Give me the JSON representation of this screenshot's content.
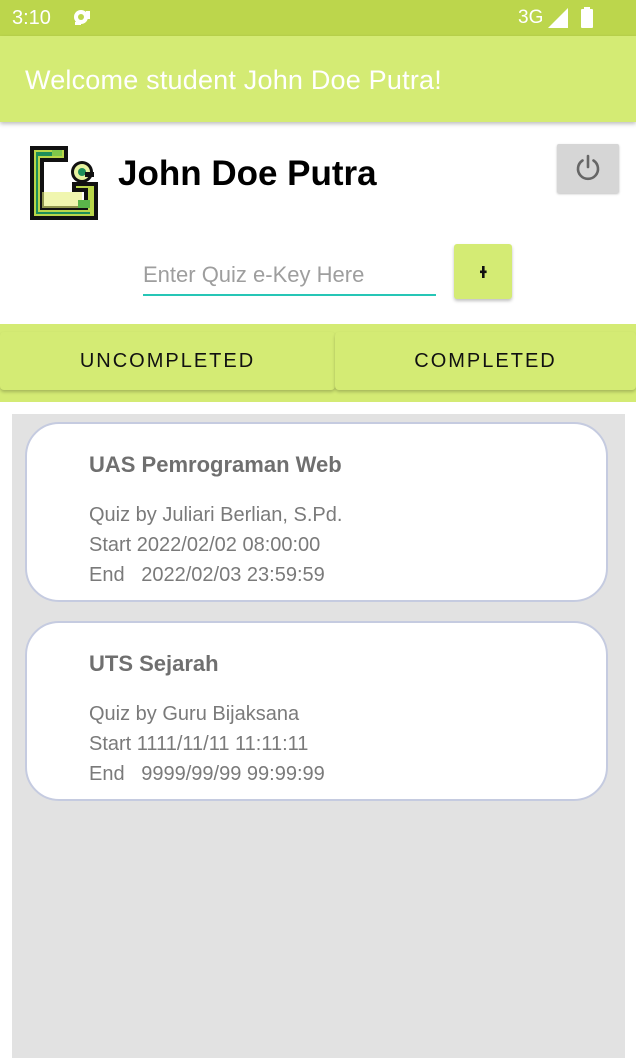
{
  "status_bar": {
    "time": "3:10",
    "network": "3G",
    "icons": [
      "notification-icon",
      "signal-icon",
      "battery-icon"
    ]
  },
  "app_bar": {
    "title": "Welcome student John Doe Putra!"
  },
  "profile": {
    "name": "John Doe Putra",
    "logo_icon": "app-logo-icon",
    "power_icon": "power-icon"
  },
  "quiz_key": {
    "placeholder": "Enter Quiz e-Key Here",
    "value": "",
    "add_icon": "add-icon",
    "add_label": "+"
  },
  "tabs": [
    {
      "label": "UNCOMPLETED"
    },
    {
      "label": "COMPLETED"
    }
  ],
  "quizzes": [
    {
      "title": "UAS Pemrograman Web",
      "author": "Quiz by Juliari Berlian, S.Pd.",
      "start": "Start 2022/02/02 08:00:00",
      "end": "End   2022/02/03 23:59:59"
    },
    {
      "title": "UTS Sejarah",
      "author": "Quiz by Guru Bijaksana",
      "start": "Start 1111/11/11 11:11:11",
      "end": "End   9999/99/99 99:99:99"
    }
  ],
  "colors": {
    "status_bar": "#bcd64c",
    "primary": "#d4eb74",
    "input_underline": "#26c6b6",
    "card_border": "#c5cbe0",
    "list_background": "#e2e2e2"
  }
}
